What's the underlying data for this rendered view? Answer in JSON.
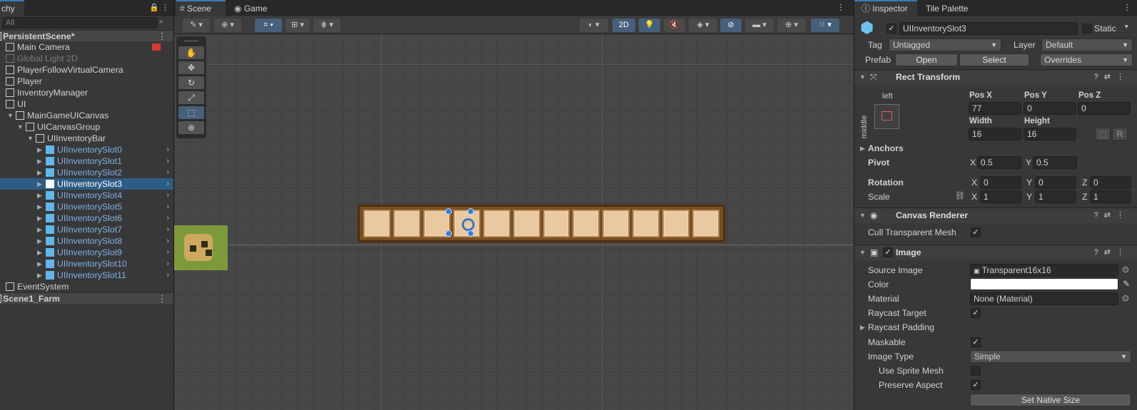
{
  "hierarchy": {
    "tab_label": "chy",
    "search_placeholder": "All",
    "items": [
      {
        "label": "PersistentScene*",
        "kind": "scene"
      },
      {
        "label": "Main Camera"
      },
      {
        "label": "Global Light 2D"
      },
      {
        "label": "PlayerFollowVirtualCamera"
      },
      {
        "label": "Player"
      },
      {
        "label": "InventoryManager"
      },
      {
        "label": "UI"
      },
      {
        "label": "MainGameUICanvas"
      },
      {
        "label": "UICanvasGroup"
      },
      {
        "label": "UIInventoryBar"
      },
      {
        "label": "UIInventorySlot0"
      },
      {
        "label": "UIInventorySlot1"
      },
      {
        "label": "UIInventorySlot2"
      },
      {
        "label": "UIInventorySlot3"
      },
      {
        "label": "UIInventorySlot4"
      },
      {
        "label": "UIInventorySlot5"
      },
      {
        "label": "UIInventorySlot6"
      },
      {
        "label": "UIInventorySlot7"
      },
      {
        "label": "UIInventorySlot8"
      },
      {
        "label": "UIInventorySlot9"
      },
      {
        "label": "UIInventorySlot10"
      },
      {
        "label": "UIInventorySlot11"
      },
      {
        "label": "EventSystem"
      },
      {
        "label": "Scene1_Farm",
        "kind": "scene"
      }
    ]
  },
  "scene": {
    "tab_scene": "Scene",
    "tab_game": "Game",
    "mode_2d": "2D"
  },
  "inspector": {
    "tab_inspector": "Inspector",
    "tab_tile_palette": "Tile Palette",
    "object_name": "UIInventorySlot3",
    "static_label": "Static",
    "tag_label": "Tag",
    "tag_value": "Untagged",
    "layer_label": "Layer",
    "layer_value": "Default",
    "prefab_label": "Prefab",
    "open_label": "Open",
    "select_label": "Select",
    "overrides_label": "Overrides",
    "rect_transform": {
      "title": "Rect Transform",
      "anchor_h": "left",
      "anchor_v": "middle",
      "pos_x_label": "Pos X",
      "pos_x": "77",
      "pos_y_label": "Pos Y",
      "pos_y": "0",
      "pos_z_label": "Pos Z",
      "pos_z": "0",
      "width_label": "Width",
      "width": "16",
      "height_label": "Height",
      "height": "16",
      "r_label": "R",
      "anchors_label": "Anchors",
      "pivot_label": "Pivot",
      "pivot_x": "0.5",
      "pivot_y": "0.5",
      "rotation_label": "Rotation",
      "rot_x": "0",
      "rot_y": "0",
      "rot_z": "0",
      "scale_label": "Scale",
      "scale_x": "1",
      "scale_y": "1",
      "scale_z": "1",
      "x": "X",
      "y": "Y",
      "z": "Z"
    },
    "canvas_renderer": {
      "title": "Canvas Renderer",
      "cull_label": "Cull Transparent Mesh"
    },
    "image": {
      "title": "Image",
      "source_label": "Source Image",
      "source_value": "Transparent16x16",
      "color_label": "Color",
      "material_label": "Material",
      "material_value": "None (Material)",
      "raycast_target_label": "Raycast Target",
      "raycast_padding_label": "Raycast Padding",
      "maskable_label": "Maskable",
      "image_type_label": "Image Type",
      "image_type_value": "Simple",
      "use_sprite_mesh_label": "Use Sprite Mesh",
      "preserve_aspect_label": "Preserve Aspect",
      "set_native_label": "Set Native Size"
    }
  }
}
